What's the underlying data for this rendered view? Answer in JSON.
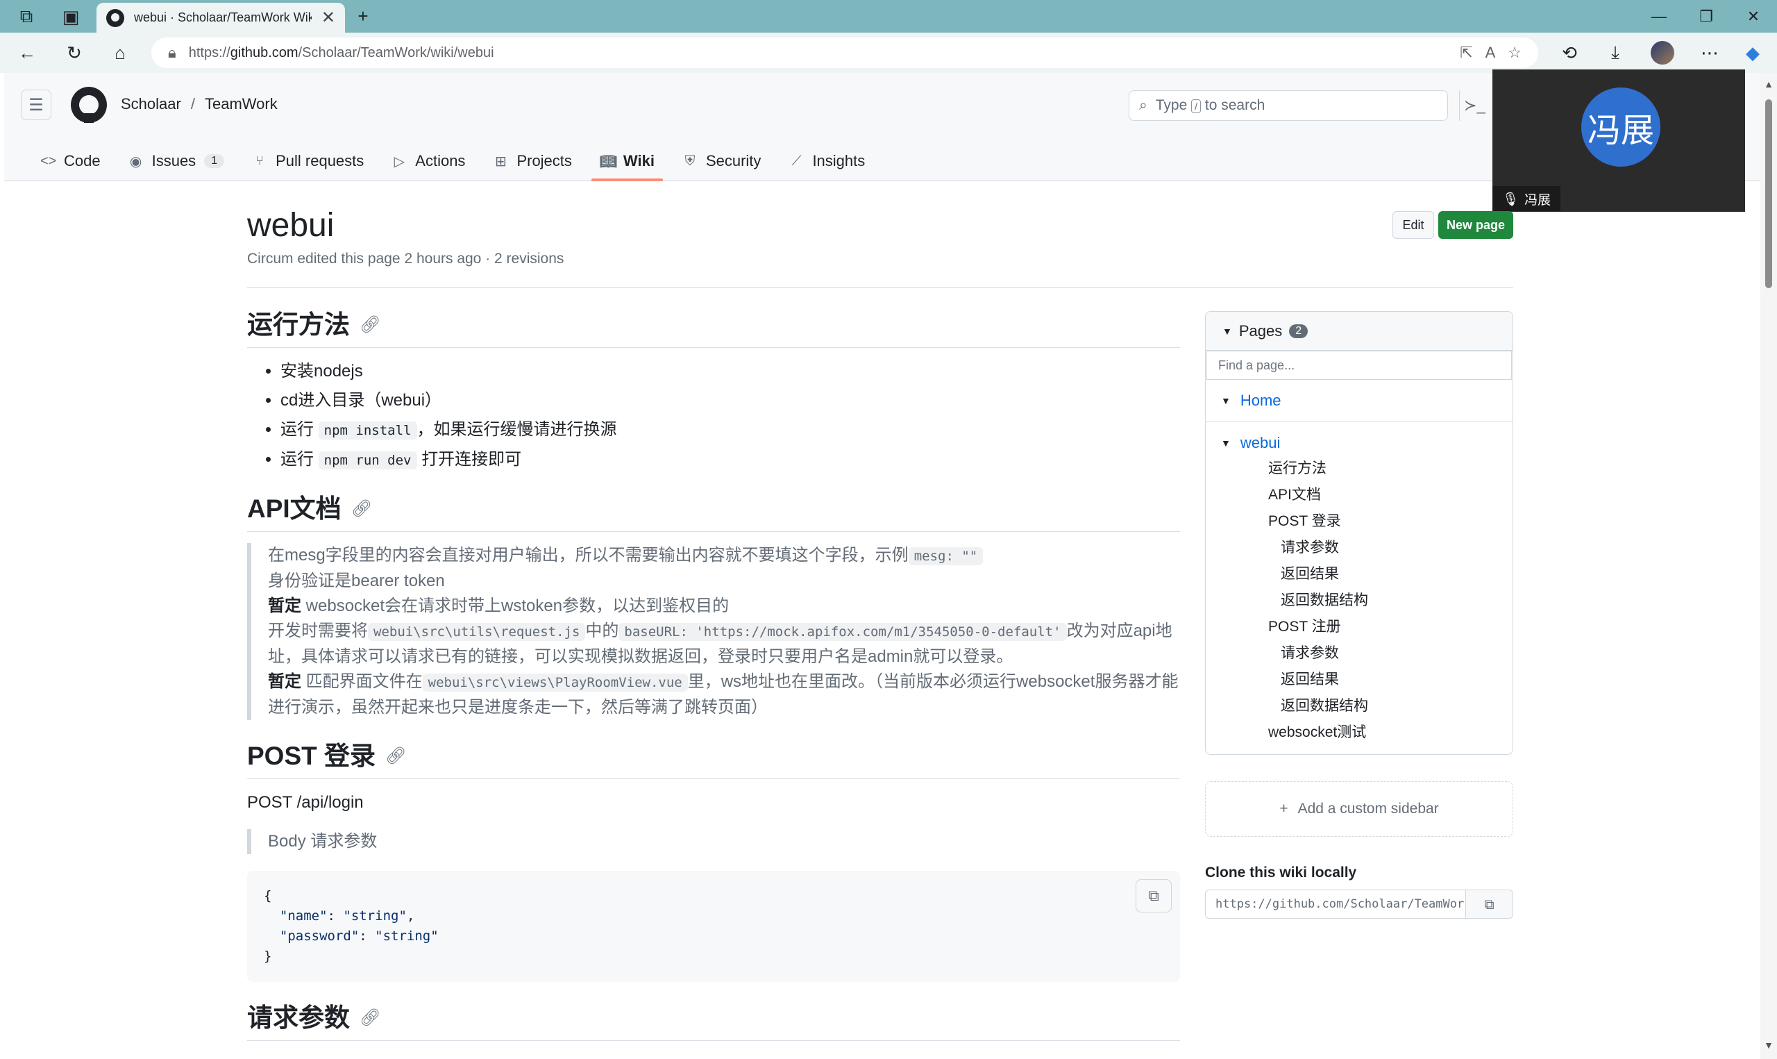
{
  "browser": {
    "tab_title": "webui · Scholaar/TeamWork Wiki",
    "url_prefix": "https://",
    "url_host": "github.com",
    "url_path": "/Scholaar/TeamWork/wiki/webui"
  },
  "header": {
    "owner": "Scholaar",
    "separator": "/",
    "repo": "TeamWork",
    "search_prefix": "Type",
    "search_key": "/",
    "search_suffix": "to search"
  },
  "nav": {
    "code": "Code",
    "issues": "Issues",
    "issues_count": "1",
    "pull_requests": "Pull requests",
    "actions": "Actions",
    "projects": "Projects",
    "wiki": "Wiki",
    "security": "Security",
    "insights": "Insights"
  },
  "video": {
    "avatar_text": "冯展",
    "name": "冯展"
  },
  "page": {
    "title": "webui",
    "meta": "Circum edited this page 2 hours ago · 2 revisions",
    "edit_label": "Edit",
    "new_page_label": "New page"
  },
  "content": {
    "h_run": "运行方法",
    "run_items": {
      "i1": "安装nodejs",
      "i2": "cd进入目录（webui）",
      "i3_pre": "运行",
      "i3_code": "npm install",
      "i3_post": "，如果运行缓慢请进行换源",
      "i4_pre": "运行",
      "i4_code": "npm run dev",
      "i4_post": "打开连接即可"
    },
    "h_api": "API文档",
    "api_quote": {
      "l1_pre": "在mesg字段里的内容会直接对用户输出，所以不需要输出内容就不要填这个字段，示例",
      "l1_code": "mesg: \"\"",
      "l2": "身份验证是bearer token",
      "l3_strong": "暂定",
      "l3_text": " websocket会在请求时带上wstoken参数，以达到鉴权目的",
      "l4_pre": "开发时需要将",
      "l4_code1": "webui\\src\\utils\\request.js",
      "l4_mid": "中的",
      "l4_code2": "baseURL: 'https://mock.apifox.com/m1/3545050-0-default'",
      "l4_post": "改为对应api地址，具体请求可以请求已有的链接，可以实现模拟数据返回，登录时只要用户名是admin就可以登录。",
      "l5_strong": "暂定",
      "l5_pre": " 匹配界面文件在",
      "l5_code": "webui\\src\\views\\PlayRoomView.vue",
      "l5_post": "里，ws地址也在里面改。（当前版本必须运行websocket服务器才能进行演示，虽然开起来也只是进度条走一下，然后等满了跳转页面）"
    },
    "h_login": "POST 登录",
    "login_endpoint": "POST /api/login",
    "login_quote": "Body 请求参数",
    "code_open": "{",
    "code_name_key": "\"name\"",
    "code_name_val": "\"string\"",
    "code_pass_key": "\"password\"",
    "code_pass_val": "\"string\"",
    "code_close": "}",
    "h_params": "请求参数"
  },
  "sidebar": {
    "pages_label": "Pages",
    "pages_count": "2",
    "find_placeholder": "Find a page...",
    "home": "Home",
    "webui": "webui",
    "toc": {
      "t1": "运行方法",
      "t2": "API文档",
      "t3": "POST 登录",
      "t4": "请求参数",
      "t5": "返回结果",
      "t6": "返回数据结构",
      "t7": "POST 注册",
      "t8": "请求参数",
      "t9": "返回结果",
      "t10": "返回数据结构",
      "t11": "websocket测试"
    },
    "add_custom": "Add a custom sidebar",
    "clone_title": "Clone this wiki locally",
    "clone_url": "https://github.com/Scholaar/TeamWork.wiki.git"
  }
}
